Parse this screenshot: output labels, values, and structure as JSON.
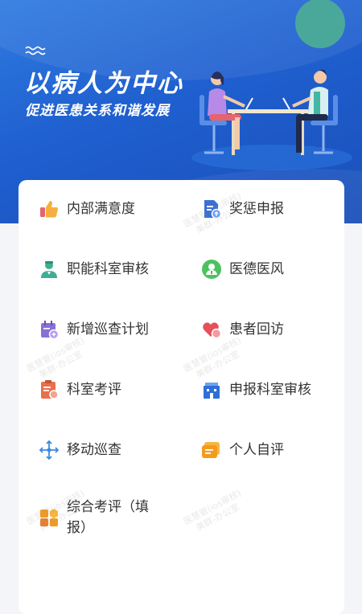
{
  "banner": {
    "headline": "以病人为中心",
    "subheadline": "促进医患关系和谐发展"
  },
  "menu": {
    "items": [
      {
        "label": "内部满意度",
        "icon": "thumbs-up-icon"
      },
      {
        "label": "奖惩申报",
        "icon": "document-upload-icon"
      },
      {
        "label": "职能科室审核",
        "icon": "doctor-icon"
      },
      {
        "label": "医德医风",
        "icon": "doctor-badge-icon"
      },
      {
        "label": "新增巡查计划",
        "icon": "calendar-add-icon"
      },
      {
        "label": "患者回访",
        "icon": "heart-chat-icon"
      },
      {
        "label": "科室考评",
        "icon": "clipboard-icon"
      },
      {
        "label": "申报科室审核",
        "icon": "building-icon"
      },
      {
        "label": "移动巡查",
        "icon": "move-arrows-icon"
      },
      {
        "label": "个人自评",
        "icon": "message-card-icon"
      },
      {
        "label": "综合考评（填",
        "label_line2": "报）",
        "icon": "grid-hexagon-icon"
      }
    ]
  },
  "watermark": {
    "line1": "医慧管(ios审核)",
    "line2": "美群-办公室"
  },
  "colors": {
    "banner_blue": "#1f5fcf",
    "teal_circle": "#4aa89b",
    "card_bg": "#ffffff",
    "page_bg": "#f3f5f9"
  }
}
